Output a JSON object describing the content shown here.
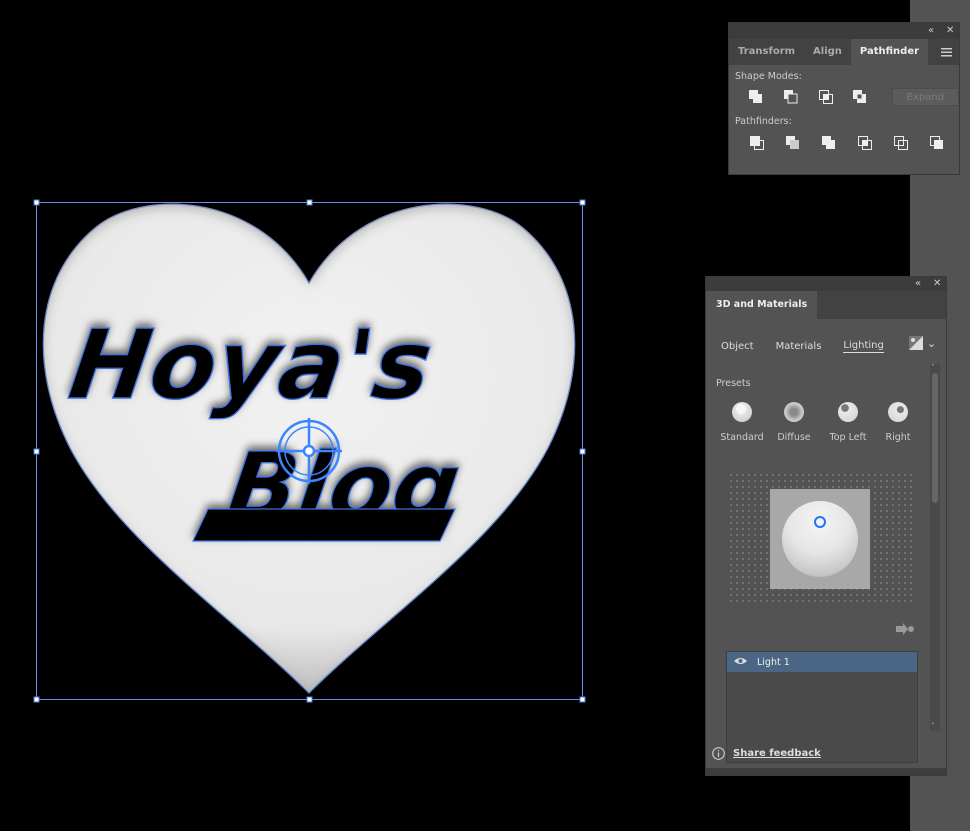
{
  "pathfinder_panel": {
    "tabs": [
      "Transform",
      "Align",
      "Pathfinder"
    ],
    "active_tab": "Pathfinder",
    "shape_modes_label": "Shape Modes:",
    "expand_label": "Expand",
    "pathfinders_label": "Pathfinders:"
  },
  "materials_panel": {
    "title": "3D and Materials",
    "subtabs": [
      "Object",
      "Materials",
      "Lighting"
    ],
    "active_subtab": "Lighting",
    "presets_label": "Presets",
    "presets": [
      "Standard",
      "Diffuse",
      "Top Left",
      "Right"
    ],
    "light_item": "Light 1",
    "feedback_label": "Share feedback"
  },
  "artwork": {
    "text_line1": "Hoya's",
    "text_line2": "Blog"
  },
  "colors": {
    "selection": "#4a7bd8",
    "panel_bg": "#535353",
    "selected_row": "#4b6685",
    "accent": "#1e73ff"
  }
}
